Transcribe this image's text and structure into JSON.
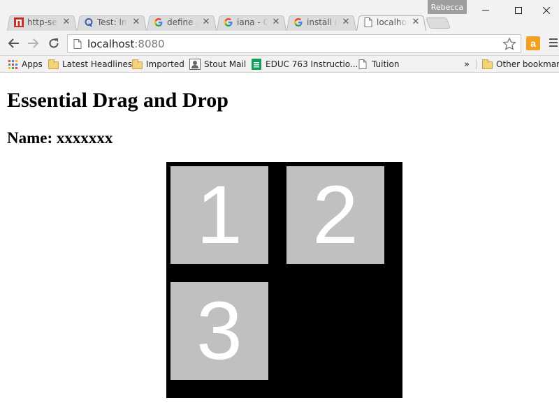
{
  "browser": {
    "profile_name": "Rebecca",
    "tabs": [
      {
        "title": "http-ser",
        "icon": "n-app-icon",
        "active": false
      },
      {
        "title": "Test: Inte",
        "icon": "quizlet-q-icon",
        "active": false
      },
      {
        "title": "define p",
        "icon": "google-icon",
        "active": false
      },
      {
        "title": "iana - Go",
        "icon": "google-icon",
        "active": false
      },
      {
        "title": "install no",
        "icon": "google-icon",
        "active": false
      },
      {
        "title": "localhos",
        "icon": "page-icon",
        "active": true
      }
    ],
    "window_controls": {
      "minimize": "—",
      "maximize": "☐",
      "close": "✕"
    },
    "url_host": "localhost",
    "url_port": ":8080"
  },
  "bookmarks": {
    "items": [
      {
        "label": "Apps",
        "icon": "apps-grid-icon"
      },
      {
        "label": "Latest Headlines",
        "icon": "folder-icon"
      },
      {
        "label": "Imported",
        "icon": "folder-icon"
      },
      {
        "label": "Stout Mail",
        "icon": "stout-mail-icon"
      },
      {
        "label": "EDUC 763 Instructio...",
        "icon": "sheets-icon"
      },
      {
        "label": "Tuition",
        "icon": "page-icon"
      }
    ],
    "overflow": "»",
    "other": "Other bookmarks"
  },
  "page": {
    "title": "Essential Drag and Drop",
    "name_line": "Name: xxxxxxx",
    "tiles": [
      "1",
      "2",
      "3"
    ]
  },
  "colors": {
    "grid_background": "#000000",
    "tile_background": "#c0c0c0",
    "tile_text": "#ffffff",
    "amazon_extension": "#f3a021"
  }
}
